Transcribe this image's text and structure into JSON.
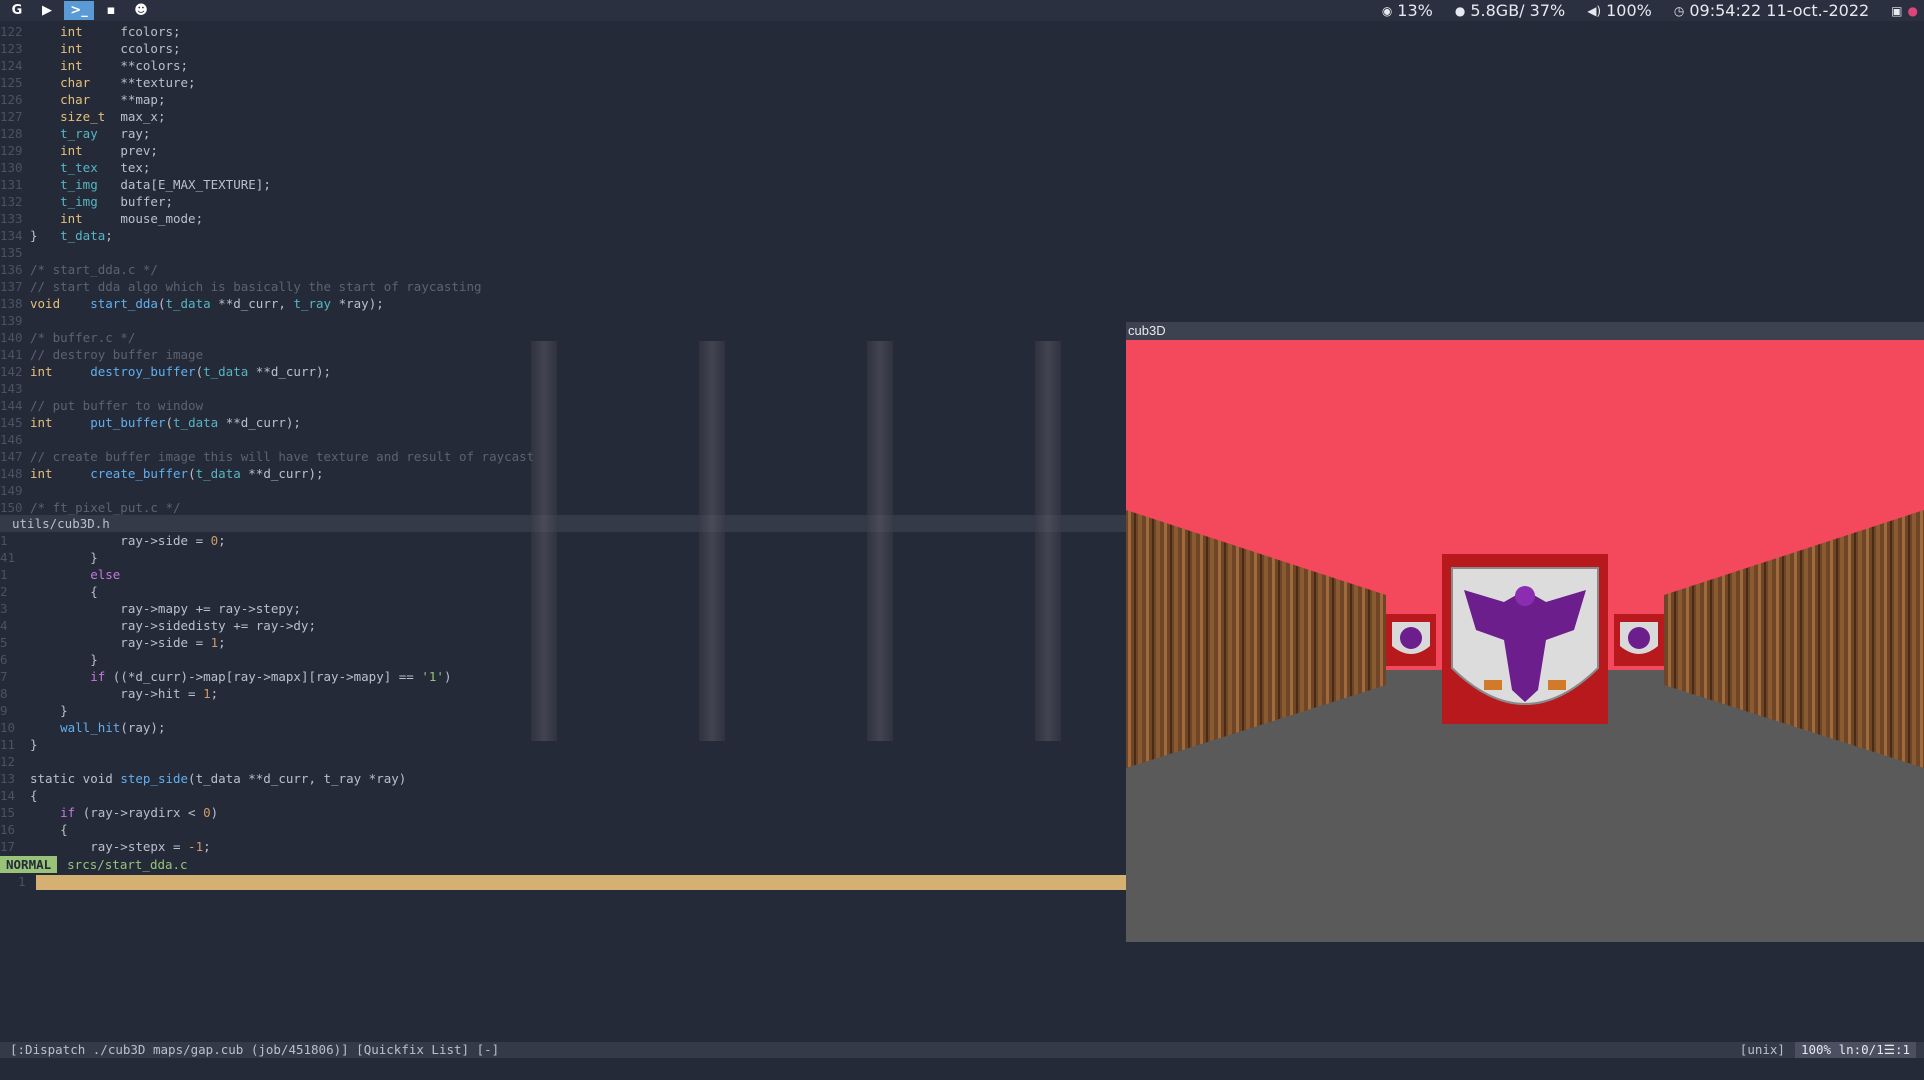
{
  "topbar": {
    "workspaces": [
      {
        "icon": "google-icon",
        "glyph": "G"
      },
      {
        "icon": "youtube-icon",
        "glyph": "▶"
      },
      {
        "icon": "terminal-icon",
        "glyph": ">_"
      },
      {
        "icon": "folder-icon",
        "glyph": "▪"
      },
      {
        "icon": "wechat-icon",
        "glyph": "☻"
      }
    ],
    "cpu": "13%",
    "memory": "5.8GB/ 37%",
    "volume": "100%",
    "clock": "09:54:22 11-oct.-2022"
  },
  "editor": {
    "top_lines": [
      {
        "n": "122",
        "tokens": [
          [
            "    ",
            "tx"
          ],
          [
            "int",
            "kw"
          ],
          [
            "     fcolors;",
            "tx"
          ]
        ]
      },
      {
        "n": "123",
        "tokens": [
          [
            "    ",
            "tx"
          ],
          [
            "int",
            "kw"
          ],
          [
            "     ccolors;",
            "tx"
          ]
        ]
      },
      {
        "n": "124",
        "tokens": [
          [
            "    ",
            "tx"
          ],
          [
            "int",
            "kw"
          ],
          [
            "     **colors;",
            "tx"
          ]
        ]
      },
      {
        "n": "125",
        "tokens": [
          [
            "    ",
            "tx"
          ],
          [
            "char",
            "kw"
          ],
          [
            "    **texture;",
            "tx"
          ]
        ]
      },
      {
        "n": "126",
        "tokens": [
          [
            "    ",
            "tx"
          ],
          [
            "char",
            "kw"
          ],
          [
            "    **map;",
            "tx"
          ]
        ]
      },
      {
        "n": "127",
        "tokens": [
          [
            "    ",
            "tx"
          ],
          [
            "size_t",
            "kw"
          ],
          [
            "  max_x;",
            "tx"
          ]
        ]
      },
      {
        "n": "128",
        "tokens": [
          [
            "    ",
            "tx"
          ],
          [
            "t_ray",
            "ty"
          ],
          [
            "   ray;",
            "tx"
          ]
        ]
      },
      {
        "n": "129",
        "tokens": [
          [
            "    ",
            "tx"
          ],
          [
            "int",
            "kw"
          ],
          [
            "     prev;",
            "tx"
          ]
        ]
      },
      {
        "n": "130",
        "tokens": [
          [
            "    ",
            "tx"
          ],
          [
            "t_tex",
            "ty"
          ],
          [
            "   tex;",
            "tx"
          ]
        ]
      },
      {
        "n": "131",
        "tokens": [
          [
            "    ",
            "tx"
          ],
          [
            "t_img",
            "ty"
          ],
          [
            "   data[E_MAX_TEXTURE];",
            "tx"
          ]
        ]
      },
      {
        "n": "132",
        "tokens": [
          [
            "    ",
            "tx"
          ],
          [
            "t_img",
            "ty"
          ],
          [
            "   buffer;",
            "tx"
          ]
        ]
      },
      {
        "n": "133",
        "tokens": [
          [
            "    ",
            "tx"
          ],
          [
            "int",
            "kw"
          ],
          [
            "     mouse_mode;",
            "tx"
          ]
        ]
      },
      {
        "n": "134",
        "tokens": [
          [
            "}   ",
            "tx"
          ],
          [
            "t_data",
            "ty"
          ],
          [
            ";",
            "tx"
          ]
        ]
      },
      {
        "n": "135",
        "tokens": []
      },
      {
        "n": "136",
        "tokens": [
          [
            "/* start_dda.c */",
            "cm"
          ]
        ]
      },
      {
        "n": "137",
        "tokens": [
          [
            "// start dda algo which is basically the start of raycasting",
            "cm"
          ]
        ]
      },
      {
        "n": "138",
        "tokens": [
          [
            "void",
            "kw"
          ],
          [
            "    ",
            "tx"
          ],
          [
            "start_dda",
            "fn"
          ],
          [
            "(",
            "tx"
          ],
          [
            "t_data",
            "ty"
          ],
          [
            " **d_curr, ",
            "tx"
          ],
          [
            "t_ray",
            "ty"
          ],
          [
            " *ray);",
            "tx"
          ]
        ]
      },
      {
        "n": "139",
        "tokens": []
      },
      {
        "n": "140",
        "tokens": [
          [
            "/* buffer.c */",
            "cm"
          ]
        ]
      },
      {
        "n": "141",
        "tokens": [
          [
            "// destroy buffer image",
            "cm"
          ]
        ]
      },
      {
        "n": "142",
        "tokens": [
          [
            "int",
            "kw"
          ],
          [
            "     ",
            "tx"
          ],
          [
            "destroy_buffer",
            "fn"
          ],
          [
            "(",
            "tx"
          ],
          [
            "t_data",
            "ty"
          ],
          [
            " **d_curr);",
            "tx"
          ]
        ]
      },
      {
        "n": "143",
        "tokens": []
      },
      {
        "n": "144",
        "tokens": [
          [
            "// put buffer to window",
            "cm"
          ]
        ]
      },
      {
        "n": "145",
        "tokens": [
          [
            "int",
            "kw"
          ],
          [
            "     ",
            "tx"
          ],
          [
            "put_buffer",
            "fn"
          ],
          [
            "(",
            "tx"
          ],
          [
            "t_data",
            "ty"
          ],
          [
            " **d_curr);",
            "tx"
          ]
        ]
      },
      {
        "n": "146",
        "tokens": []
      },
      {
        "n": "147",
        "tokens": [
          [
            "// create buffer image this will have texture and result of raycast",
            "cm"
          ]
        ]
      },
      {
        "n": "148",
        "tokens": [
          [
            "int",
            "kw"
          ],
          [
            "     ",
            "tx"
          ],
          [
            "create_buffer",
            "fn"
          ],
          [
            "(",
            "tx"
          ],
          [
            "t_data",
            "ty"
          ],
          [
            " **d_curr);",
            "tx"
          ]
        ]
      },
      {
        "n": "149",
        "tokens": []
      },
      {
        "n": "150",
        "tokens": [
          [
            "/* ft_pixel_put.c */",
            "cm"
          ]
        ]
      }
    ],
    "top_winbar": "utils/cub3D.h",
    "bottom_lines": [
      {
        "n": "1",
        "tokens": [
          [
            "            ray->side = ",
            "tx"
          ],
          [
            "0",
            "nm"
          ],
          [
            ";",
            "tx"
          ]
        ]
      },
      {
        "n": "41",
        "tokens": [
          [
            "        }",
            "tx"
          ]
        ]
      },
      {
        "n": "1",
        "tokens": [
          [
            "        ",
            "tx"
          ],
          [
            "else",
            "flow"
          ]
        ]
      },
      {
        "n": "2",
        "tokens": [
          [
            "        {",
            "tx"
          ]
        ]
      },
      {
        "n": "3",
        "tokens": [
          [
            "            ray->mapy += ray->stepy;",
            "tx"
          ]
        ]
      },
      {
        "n": "4",
        "tokens": [
          [
            "            ray->sidedisty += ray->dy;",
            "tx"
          ]
        ]
      },
      {
        "n": "5",
        "tokens": [
          [
            "            ray->side = ",
            "tx"
          ],
          [
            "1",
            "nm"
          ],
          [
            ";",
            "tx"
          ]
        ]
      },
      {
        "n": "6",
        "tokens": [
          [
            "        }",
            "tx"
          ]
        ]
      },
      {
        "n": "7",
        "tokens": [
          [
            "        ",
            "tx"
          ],
          [
            "if",
            "flow"
          ],
          [
            " ((*d_curr)->map[ray->mapx][ray->mapy] == ",
            "tx"
          ],
          [
            "'1'",
            "st"
          ],
          [
            ")",
            "tx"
          ]
        ]
      },
      {
        "n": "8",
        "tokens": [
          [
            "            ray->hit = ",
            "tx"
          ],
          [
            "1",
            "nm"
          ],
          [
            ";",
            "tx"
          ]
        ]
      },
      {
        "n": "9",
        "tokens": [
          [
            "    }",
            "tx"
          ]
        ]
      },
      {
        "n": "10",
        "tokens": [
          [
            "    ",
            "tx"
          ],
          [
            "wall_hit",
            "fn"
          ],
          [
            "(ray);",
            "tx"
          ]
        ]
      },
      {
        "n": "11",
        "tokens": [
          [
            "}",
            "tx"
          ]
        ]
      },
      {
        "n": "12",
        "tokens": []
      },
      {
        "n": "13",
        "tokens": [
          [
            "static void ",
            "tx"
          ],
          [
            "step_side",
            "fn"
          ],
          [
            "(t_data **d_curr, t_ray *ray)",
            "tx"
          ]
        ]
      },
      {
        "n": "14",
        "tokens": [
          [
            "{",
            "tx"
          ]
        ]
      },
      {
        "n": "15",
        "tokens": [
          [
            "    ",
            "tx"
          ],
          [
            "if",
            "flow"
          ],
          [
            " (ray->raydirx < ",
            "tx"
          ],
          [
            "0",
            "nm"
          ],
          [
            ")",
            "tx"
          ]
        ]
      },
      {
        "n": "16",
        "tokens": [
          [
            "    {",
            "tx"
          ]
        ]
      },
      {
        "n": "17",
        "tokens": [
          [
            "        ray->stepx = ",
            "tx"
          ],
          [
            "-1",
            "nm"
          ],
          [
            ";",
            "tx"
          ]
        ]
      }
    ],
    "mode": "NORMAL",
    "status_file": "srcs/start_dda.c",
    "quickfix_line": "1",
    "cmdline": "[:Dispatch ./cub3D maps/gap.cub (job/451806)] [Quickfix List] [-]",
    "fileformat": "[unix]",
    "position": "100% ln:0/1☰:1"
  },
  "game": {
    "title": "cub3D",
    "ceiling_color": "#f4485c",
    "floor_color": "#5a5a5a",
    "wall_wood": "#7a5230",
    "banner_red": "#b8191d",
    "eagle_purple": "#6b1e8c"
  }
}
